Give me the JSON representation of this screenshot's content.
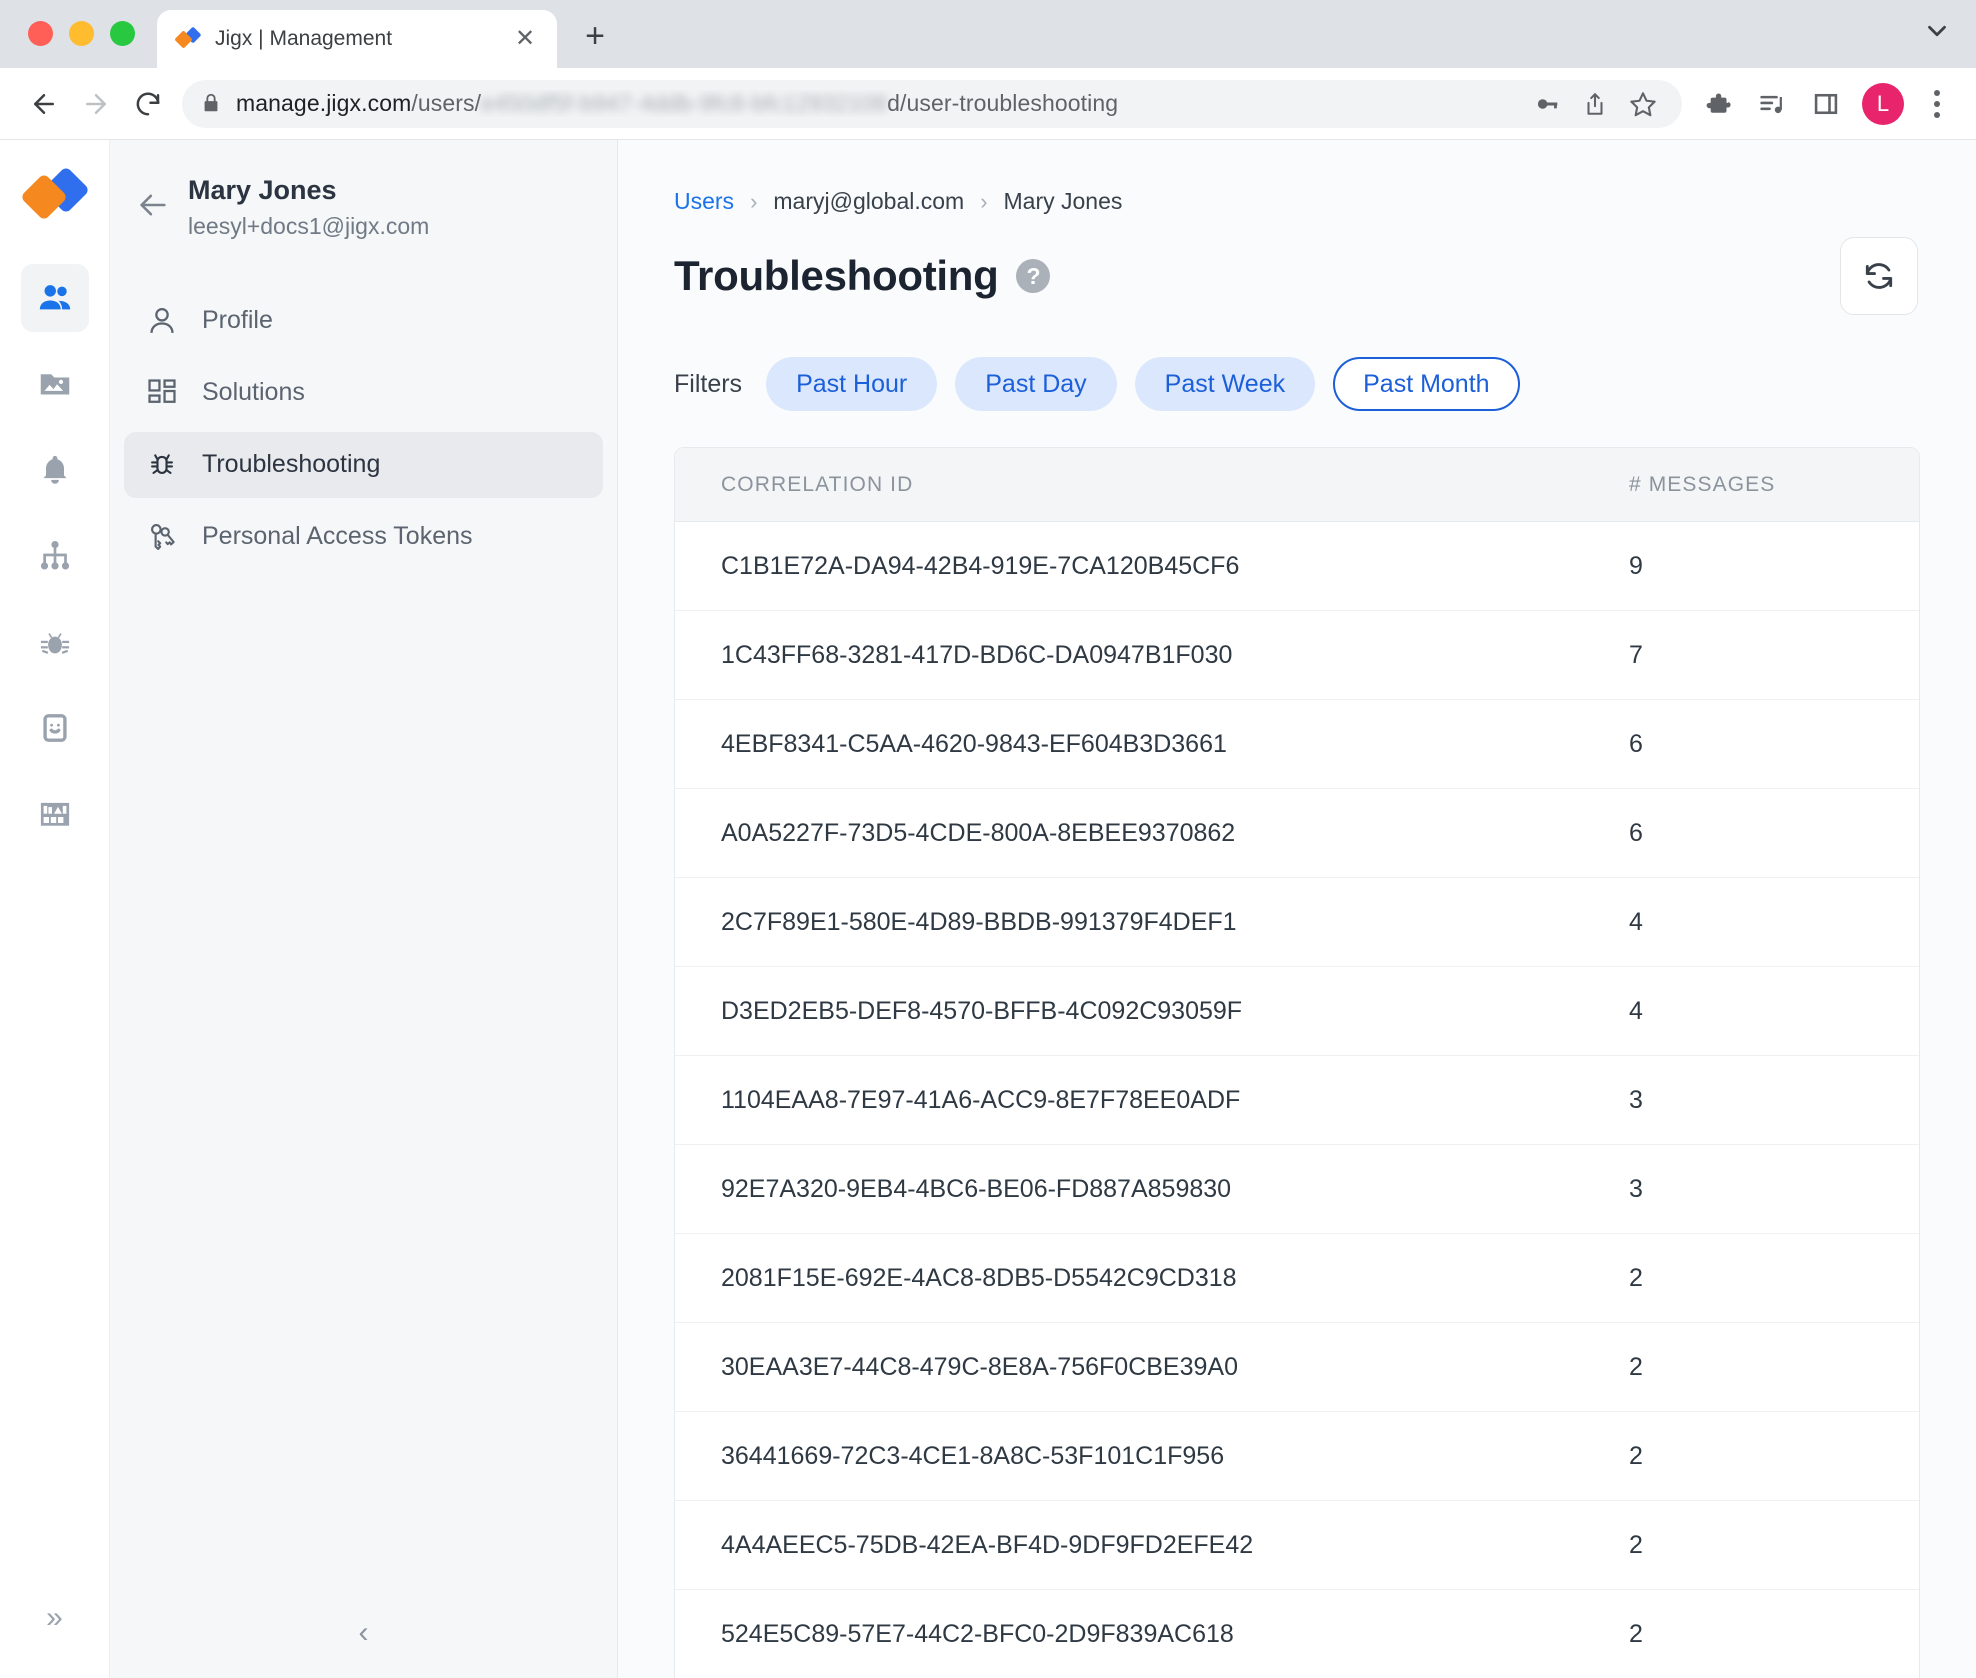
{
  "browser": {
    "tab": {
      "title": "Jigx | Management",
      "favicon": "jigx-logo-icon",
      "close_label": "✕"
    },
    "new_tab_label": "+",
    "url": {
      "prefix": "manage.jigx.com",
      "path_visible": "/users/",
      "redacted": "e450df5f-b947-4ddb-9fc8-bfc12932108",
      "suffix": "d/user-troubleshooting"
    },
    "omnibox_icons": [
      "key-icon",
      "share-icon",
      "star-icon"
    ],
    "toolbar_icons": [
      "extensions-icon",
      "media-playlist-icon",
      "side-panel-icon"
    ],
    "avatar_initial": "L"
  },
  "rail": {
    "logo": "jigx-logo-icon",
    "items": [
      {
        "name": "users",
        "icon": "users-icon",
        "active": true
      },
      {
        "name": "media",
        "icon": "image-folder-icon",
        "active": false
      },
      {
        "name": "notifications",
        "icon": "bell-icon",
        "active": false
      },
      {
        "name": "organization",
        "icon": "sitemap-icon",
        "active": false
      },
      {
        "name": "debug",
        "icon": "bug-icon",
        "active": false
      },
      {
        "name": "devices",
        "icon": "device-smiley-icon",
        "active": false
      },
      {
        "name": "library",
        "icon": "bookshelf-icon",
        "active": false
      }
    ],
    "expand_label": "»"
  },
  "subnav": {
    "back_label": "back-arrow-icon",
    "user_name": "Mary Jones",
    "user_email": "leesyl+docs1@jigx.com",
    "items": [
      {
        "label": "Profile",
        "icon": "person-icon",
        "active": false
      },
      {
        "label": "Solutions",
        "icon": "grid-blocks-icon",
        "active": false
      },
      {
        "label": "Troubleshooting",
        "icon": "bug-icon",
        "active": true
      },
      {
        "label": "Personal Access Tokens",
        "icon": "keys-icon",
        "active": false
      }
    ],
    "collapse_label": "‹"
  },
  "main": {
    "breadcrumb": [
      {
        "label": "Users",
        "link": true
      },
      {
        "label": "maryj@global.com",
        "link": false
      },
      {
        "label": "Mary Jones",
        "link": false
      }
    ],
    "breadcrumb_separator": "›",
    "page_title": "Troubleshooting",
    "help_glyph": "?",
    "refresh_label": "refresh-icon",
    "filters": {
      "label": "Filters",
      "options": [
        {
          "label": "Past Hour",
          "selected": false
        },
        {
          "label": "Past Day",
          "selected": false
        },
        {
          "label": "Past Week",
          "selected": false
        },
        {
          "label": "Past Month",
          "selected": true
        }
      ]
    },
    "table": {
      "columns": [
        "CORRELATION ID",
        "# MESSAGES"
      ],
      "rows": [
        {
          "id": "C1B1E72A-DA94-42B4-919E-7CA120B45CF6",
          "messages": "9"
        },
        {
          "id": "1C43FF68-3281-417D-BD6C-DA0947B1F030",
          "messages": "7"
        },
        {
          "id": "4EBF8341-C5AA-4620-9843-EF604B3D3661",
          "messages": "6"
        },
        {
          "id": "A0A5227F-73D5-4CDE-800A-8EBEE9370862",
          "messages": "6"
        },
        {
          "id": "2C7F89E1-580E-4D89-BBDB-991379F4DEF1",
          "messages": "4"
        },
        {
          "id": "D3ED2EB5-DEF8-4570-BFFB-4C092C93059F",
          "messages": "4"
        },
        {
          "id": "1104EAA8-7E97-41A6-ACC9-8E7F78EE0ADF",
          "messages": "3"
        },
        {
          "id": "92E7A320-9EB4-4BC6-BE06-FD887A859830",
          "messages": "3"
        },
        {
          "id": "2081F15E-692E-4AC8-8DB5-D5542C9CD318",
          "messages": "2"
        },
        {
          "id": "30EAA3E7-44C8-479C-8E8A-756F0CBE39A0",
          "messages": "2"
        },
        {
          "id": "36441669-72C3-4CE1-8A8C-53F101C1F956",
          "messages": "2"
        },
        {
          "id": "4A4AEEC5-75DB-42EA-BF4D-9DF9FD2EFE42",
          "messages": "2"
        },
        {
          "id": "524E5C89-57E7-44C2-BFC0-2D9F839AC618",
          "messages": "2"
        }
      ]
    }
  },
  "colors": {
    "accent_blue": "#1a73e8",
    "pill_bg": "#dbe7fd",
    "pill_text": "#1b5fd9",
    "logo_orange": "#f5881f",
    "logo_blue": "#2f6fed",
    "avatar_pink": "#e8246c"
  }
}
